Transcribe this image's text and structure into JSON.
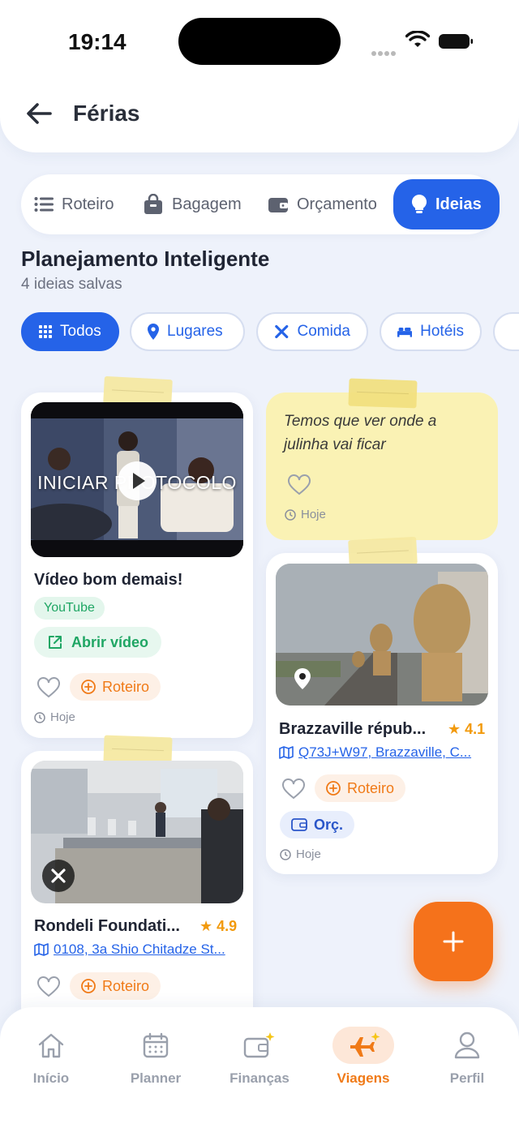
{
  "status_bar": {
    "time": "19:14"
  },
  "header": {
    "title": "Férias"
  },
  "tabs": [
    {
      "label": "Roteiro",
      "icon": "list-icon"
    },
    {
      "label": "Bagagem",
      "icon": "bag-icon"
    },
    {
      "label": "Orçamento",
      "icon": "wallet-icon"
    },
    {
      "label": "Ideias",
      "icon": "lightbulb-icon",
      "active": true
    }
  ],
  "section": {
    "title": "Planejamento Inteligente",
    "subtitle": "4 ideias salvas"
  },
  "filters": [
    {
      "label": "Todos",
      "icon": "grid-icon",
      "active": true
    },
    {
      "label": "Lugares",
      "icon": "pin-icon"
    },
    {
      "label": "Comida",
      "icon": "utensils-icon"
    },
    {
      "label": "Hotéis",
      "icon": "bed-icon"
    }
  ],
  "cards": {
    "video": {
      "overlay_text": "INICIAR PROTOCOLO",
      "title": "Vídeo bom demais!",
      "source_badge": "YouTube",
      "open_label": "Abrir vídeo",
      "roteiro_label": "Roteiro",
      "date": "Hoje"
    },
    "note": {
      "text": "Temos que ver onde a julinha vai ficar",
      "date": "Hoje"
    },
    "place": {
      "title": "Brazzaville répub...",
      "rating": "4.1",
      "address": "Q73J+W97, Brazzaville, C...",
      "roteiro_label": "Roteiro",
      "orc_label": "Orç.",
      "date": "Hoje"
    },
    "food": {
      "title": "Rondeli Foundati...",
      "rating": "4.9",
      "address": "0108, 3a Shio Chitadze St...",
      "roteiro_label": "Roteiro"
    }
  },
  "bottom_nav": [
    {
      "label": "Início",
      "icon": "home-icon"
    },
    {
      "label": "Planner",
      "icon": "calendar-icon"
    },
    {
      "label": "Finanças",
      "icon": "wallet-sparkle-icon"
    },
    {
      "label": "Viagens",
      "icon": "plane-icon",
      "active": true
    },
    {
      "label": "Perfil",
      "icon": "user-icon"
    }
  ],
  "colors": {
    "primary": "#2563e8",
    "accent": "#f5721b",
    "note": "#faf2b4"
  }
}
